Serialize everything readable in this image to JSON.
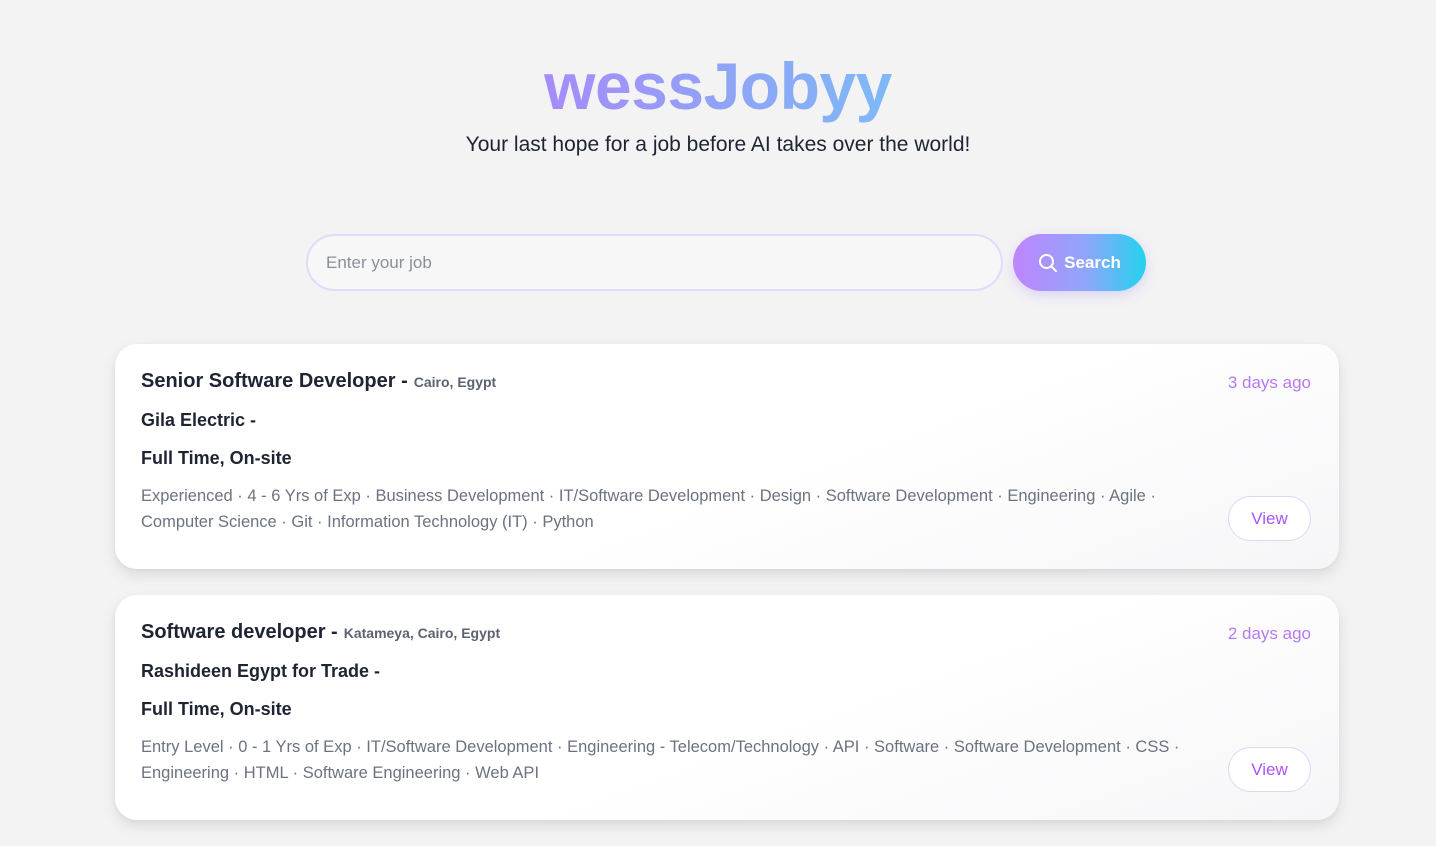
{
  "header": {
    "brand": "wessJobyy",
    "tagline": "Your last hope for a job before AI takes over the world!"
  },
  "search": {
    "placeholder": "Enter your job",
    "value": "",
    "button_label": "Search",
    "button_icon": "search-icon"
  },
  "jobs": [
    {
      "title": "Senior Software Developer -",
      "location": "Cairo, Egypt",
      "company": "Gila Electric -",
      "type": "Full Time, On-site",
      "tags": "Experienced · 4 - 6 Yrs of Exp · Business Development · IT/Software Development · Design · Software Development · Engineering · Agile · Computer Science · Git · Information Technology (IT) · Python",
      "posted": "3 days ago",
      "view_label": "View"
    },
    {
      "title": "Software developer -",
      "location": "Katameya, Cairo, Egypt",
      "company": "Rashideen Egypt for Trade -",
      "type": "Full Time, On-site",
      "tags": "Entry Level · 0 - 1 Yrs of Exp · IT/Software Development · Engineering - Telecom/Technology · API · Software · Software Development · CSS · Engineering · HTML · Software Engineering · Web API",
      "posted": "2 days ago",
      "view_label": "View"
    }
  ],
  "colors": {
    "accent": "#a855f7",
    "time": "#b57bf3",
    "brand_start": "#a78bfa",
    "brand_end": "#7fb9f6",
    "button_gradient_end": "#22d3ee"
  }
}
